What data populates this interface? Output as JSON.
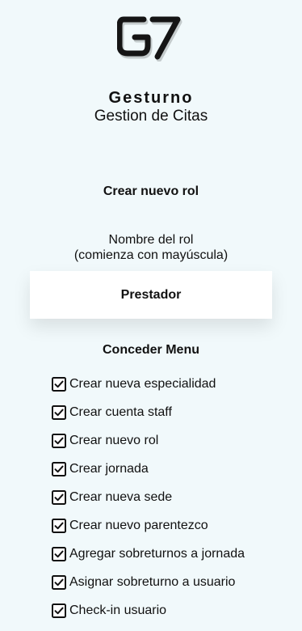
{
  "app": {
    "logo_text": "G7",
    "name": "Gesturno",
    "subtitle": "Gestion de Citas"
  },
  "page": {
    "title": "Crear nuevo rol"
  },
  "role_field": {
    "label_line1": "Nombre del rol",
    "label_line2": "(comienza con mayúscula)",
    "value": "Prestador"
  },
  "menu": {
    "title": "Conceder Menu",
    "items": [
      {
        "label": "Crear nueva especialidad",
        "checked": true
      },
      {
        "label": "Crear cuenta staff",
        "checked": true
      },
      {
        "label": "Crear nuevo rol",
        "checked": true
      },
      {
        "label": "Crear jornada",
        "checked": true
      },
      {
        "label": "Crear nueva sede",
        "checked": true
      },
      {
        "label": "Crear nuevo parentezco",
        "checked": true
      },
      {
        "label": "Agregar sobreturnos a jornada",
        "checked": true
      },
      {
        "label": "Asignar sobreturno a usuario",
        "checked": true
      },
      {
        "label": "Check-in usuario",
        "checked": true
      }
    ]
  },
  "colors": {
    "background": "#f1f9fb",
    "text": "#111111",
    "input_background": "#ffffff"
  }
}
